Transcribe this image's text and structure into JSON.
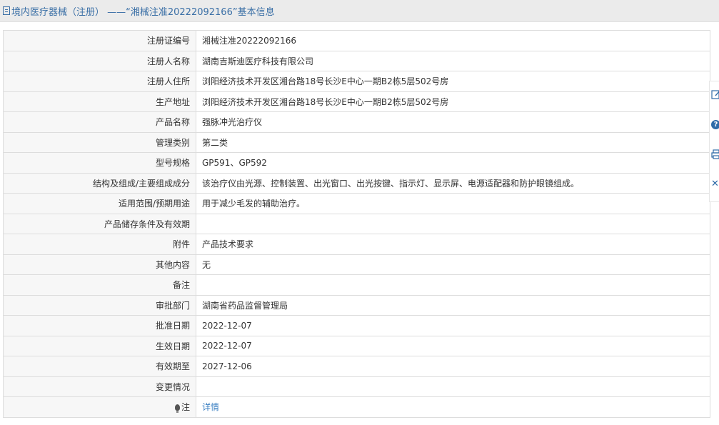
{
  "header": {
    "title": "境内医疗器械（注册） ——“湘械注准20222092166”基本信息"
  },
  "rows": [
    {
      "label": "注册证编号",
      "value": "湘械注准20222092166"
    },
    {
      "label": "注册人名称",
      "value": "湖南吉斯迪医疗科技有限公司"
    },
    {
      "label": "注册人住所",
      "value": "浏阳经济技术开发区湘台路18号长沙E中心一期B2栋5层502号房"
    },
    {
      "label": "生产地址",
      "value": "浏阳经济技术开发区湘台路18号长沙E中心一期B2栋5层502号房"
    },
    {
      "label": "产品名称",
      "value": "强脉冲光治疗仪"
    },
    {
      "label": "管理类别",
      "value": "第二类"
    },
    {
      "label": "型号规格",
      "value": "GP591、GP592"
    },
    {
      "label": "结构及组成/主要组成成分",
      "value": "该治疗仪由光源、控制装置、出光窗口、出光按键、指示灯、显示屏、电源适配器和防护眼镜组成。"
    },
    {
      "label": "适用范围/预期用途",
      "value": "用于减少毛发的辅助治疗。"
    },
    {
      "label": "产品储存条件及有效期",
      "value": ""
    },
    {
      "label": "附件",
      "value": "产品技术要求"
    },
    {
      "label": "其他内容",
      "value": "无"
    },
    {
      "label": "备注",
      "value": ""
    },
    {
      "label": "审批部门",
      "value": "湖南省药品监督管理局"
    },
    {
      "label": "批准日期",
      "value": "2022-12-07"
    },
    {
      "label": "生效日期",
      "value": "2022-12-07"
    },
    {
      "label": "有效期至",
      "value": "2027-12-06"
    },
    {
      "label": "变更情况",
      "value": ""
    }
  ],
  "note_row": {
    "label": "注",
    "link": "详情"
  },
  "side_tools": {
    "edit": "edit-icon",
    "help": "help-icon",
    "help_glyph": "?",
    "print": "print-icon",
    "close": "close-icon",
    "close_glyph": "✕"
  },
  "colors": {
    "title_text": "#3a6fa6",
    "link": "#3a7fc2",
    "label_bg": "#f7f7f7",
    "border": "#dddddd"
  }
}
